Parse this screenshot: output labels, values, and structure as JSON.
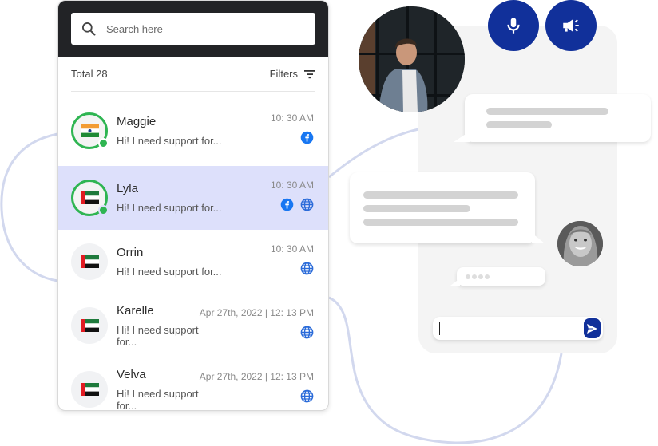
{
  "search": {
    "placeholder": "Search here"
  },
  "toolbar": {
    "total_label": "Total",
    "total_count": "28",
    "filters_label": "Filters"
  },
  "conversations": [
    {
      "name": "Maggie",
      "preview": "Hi! I need support for...",
      "time": "10: 30 AM",
      "flag": "india",
      "online": true,
      "active": false,
      "channels": [
        "facebook"
      ]
    },
    {
      "name": "Lyla",
      "preview": "Hi! I need support for...",
      "time": "10: 30 AM",
      "flag": "uae",
      "online": true,
      "active": true,
      "channels": [
        "facebook",
        "web"
      ]
    },
    {
      "name": "Orrin",
      "preview": "Hi! I need support for...",
      "time": "10: 30 AM",
      "flag": "uae",
      "online": false,
      "active": false,
      "channels": [
        "web"
      ]
    },
    {
      "name": "Karelle",
      "preview": "Hi! I need support for...",
      "time": "Apr 27th, 2022 | 12: 13 PM",
      "flag": "uae",
      "online": false,
      "active": false,
      "channels": [
        "web"
      ]
    },
    {
      "name": "Velva",
      "preview": "Hi! I need support for...",
      "time": "Apr 27th, 2022 | 12: 13 PM",
      "flag": "uae",
      "online": false,
      "active": false,
      "channels": [
        "web"
      ]
    }
  ],
  "chat": {
    "buttons": [
      "microphone",
      "megaphone"
    ],
    "compose_value": "",
    "send_icon": "send-icon"
  },
  "colors": {
    "brand": "#11309a",
    "online": "#2fb552",
    "active_row": "#dde0fb",
    "connector": "#d2d8ee",
    "facebook": "#1877f2",
    "web": "#2a6bd9"
  }
}
